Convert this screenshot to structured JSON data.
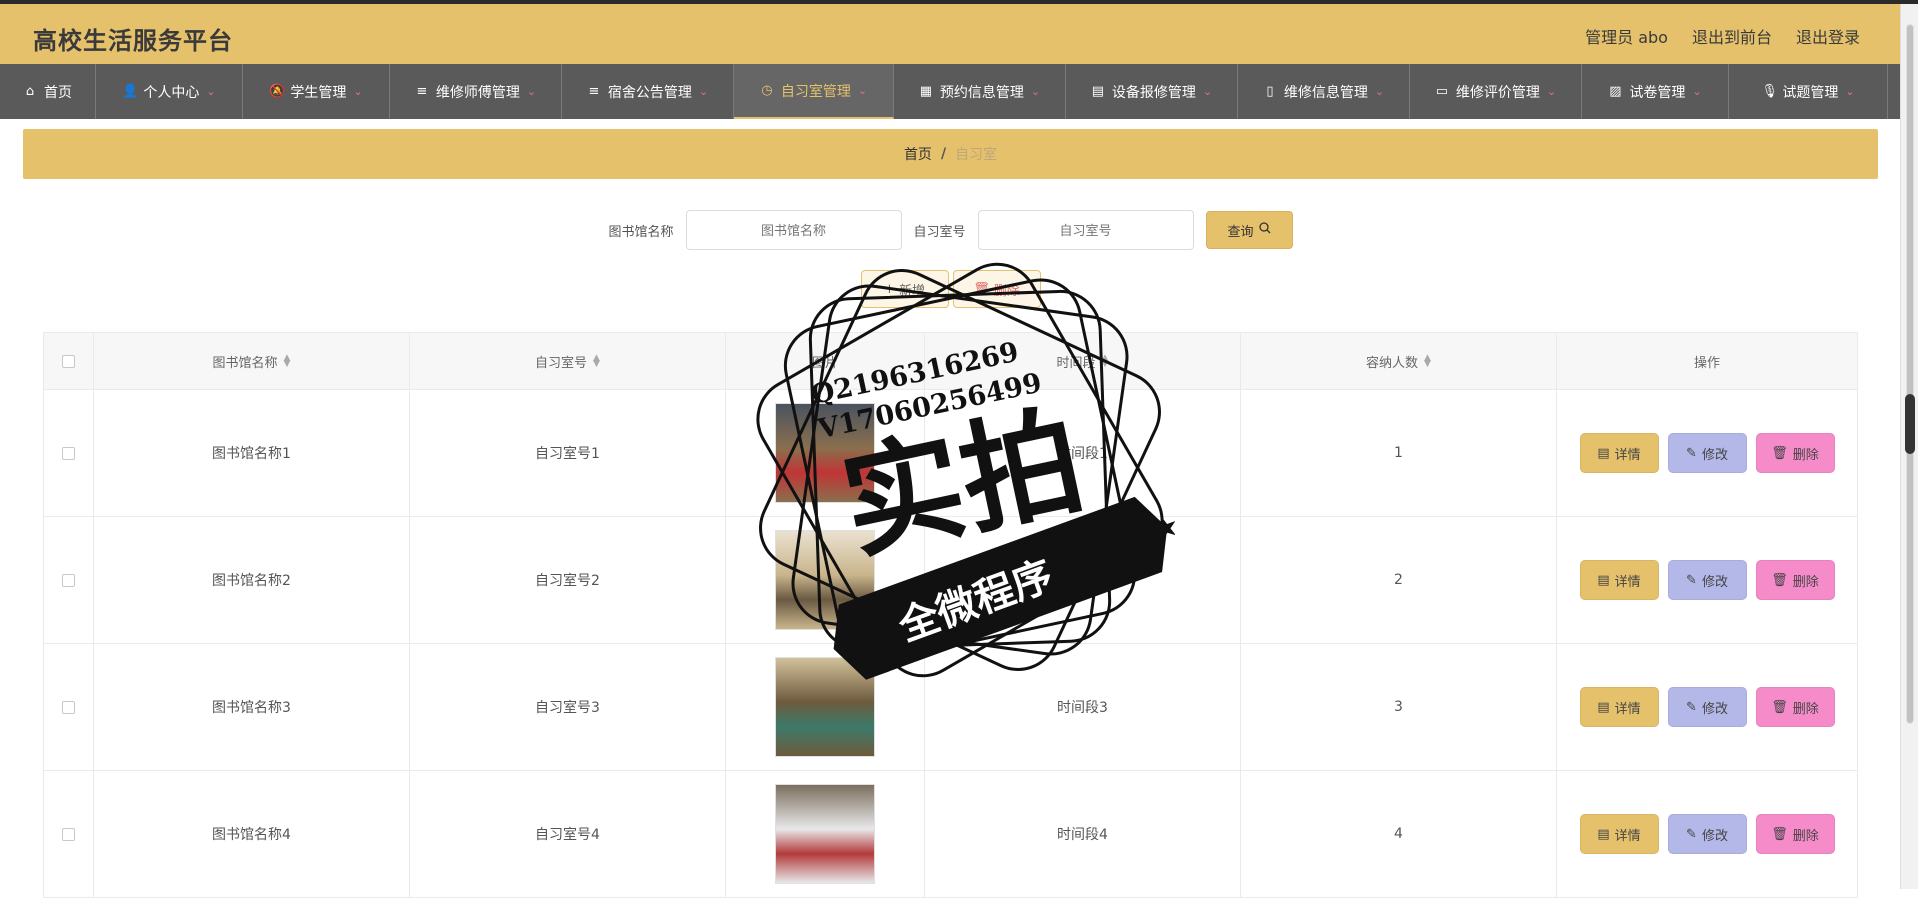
{
  "app": {
    "title": "高校生活服务平台"
  },
  "header": {
    "admin": "管理员 abo",
    "to_front": "退出到前台",
    "logout": "退出登录"
  },
  "nav": [
    {
      "label": "首页",
      "icon": "home-icon",
      "active": false,
      "dropdown": false
    },
    {
      "label": "个人中心",
      "icon": "user-icon",
      "active": false,
      "dropdown": true
    },
    {
      "label": "学生管理",
      "icon": "bell-icon",
      "active": false,
      "dropdown": true
    },
    {
      "label": "维修师傅管理",
      "icon": "list-icon",
      "active": false,
      "dropdown": true
    },
    {
      "label": "宿舍公告管理",
      "icon": "list-icon",
      "active": false,
      "dropdown": true
    },
    {
      "label": "自习室管理",
      "icon": "compass-icon",
      "active": true,
      "dropdown": true
    },
    {
      "label": "预约信息管理",
      "icon": "grid-icon",
      "active": false,
      "dropdown": true
    },
    {
      "label": "设备报修管理",
      "icon": "clipboard-icon",
      "active": false,
      "dropdown": true
    },
    {
      "label": "维修信息管理",
      "icon": "phone-icon",
      "active": false,
      "dropdown": true
    },
    {
      "label": "维修评价管理",
      "icon": "monitor-icon",
      "active": false,
      "dropdown": true
    },
    {
      "label": "试卷管理",
      "icon": "chart-icon",
      "active": false,
      "dropdown": true
    },
    {
      "label": "试题管理",
      "icon": "mic-icon",
      "active": false,
      "dropdown": true
    }
  ],
  "breadcrumb": {
    "home": "首页",
    "sep": "/",
    "current": "自习室"
  },
  "search": {
    "library_label": "图书馆名称",
    "library_placeholder": "图书馆名称",
    "room_label": "自习室号",
    "room_placeholder": "自习室号",
    "query_label": "查询"
  },
  "actions": {
    "add_label": "新增",
    "delete_label": "删除"
  },
  "table": {
    "headers": {
      "library": "图书馆名称",
      "room": "自习室号",
      "image": "图片",
      "period": "时间段",
      "capacity": "容纳人数",
      "ops": "操作"
    },
    "rows": [
      {
        "library": "图书馆名称1",
        "room": "自习室号1",
        "period": "时间段1",
        "capacity": "1",
        "image_colors": [
          "#8a6f4e",
          "#c03535",
          "#4a5360"
        ]
      },
      {
        "library": "图书馆名称2",
        "room": "自习室号2",
        "period": "时间段2",
        "capacity": "2",
        "image_colors": [
          "#c9b58c",
          "#6b5a43",
          "#e9e1cf"
        ]
      },
      {
        "library": "图书馆名称3",
        "room": "自习室号3",
        "period": "时间段3",
        "capacity": "3",
        "image_colors": [
          "#6e5a3d",
          "#3c7a6a",
          "#d1c19b"
        ]
      },
      {
        "library": "图书馆名称4",
        "room": "自习室号4",
        "period": "时间段4",
        "capacity": "4",
        "image_colors": [
          "#e8e8ea",
          "#b23a3a",
          "#7c6f5f"
        ]
      }
    ],
    "op_labels": {
      "detail": "详情",
      "edit": "修改",
      "delete": "删除"
    }
  },
  "watermark": {
    "qq": "Q2196316269",
    "vx": "V17060256499",
    "big": "实拍",
    "banner": "全微程序"
  }
}
